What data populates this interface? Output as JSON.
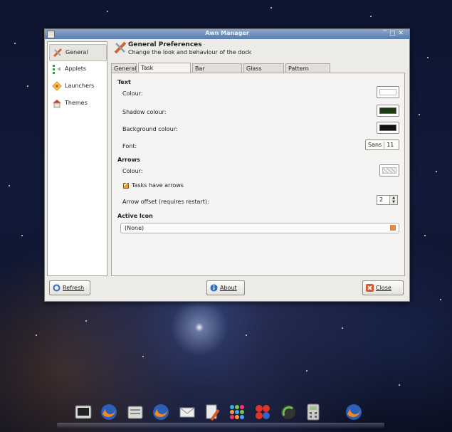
{
  "window": {
    "title": "Awn Manager"
  },
  "sidebar": {
    "items": [
      {
        "label": "General",
        "icon": "general-icon",
        "selected": true
      },
      {
        "label": "Applets",
        "icon": "applets-icon",
        "selected": false
      },
      {
        "label": "Launchers",
        "icon": "launchers-icon",
        "selected": false
      },
      {
        "label": "Themes",
        "icon": "themes-icon",
        "selected": false
      }
    ]
  },
  "header": {
    "title": "General Preferences",
    "subtitle": "Change the look and behaviour of the dock"
  },
  "tabs": [
    {
      "label": "General",
      "active": false
    },
    {
      "label": "Task Appearance",
      "active": true
    },
    {
      "label": "Bar Appearance",
      "active": false
    },
    {
      "label": "Glass Engine",
      "active": false
    },
    {
      "label": "Pattern Engine",
      "active": false
    }
  ],
  "text_section": {
    "heading": "Text",
    "colour_label": "Colour:",
    "colour_value": "#ffffff",
    "shadow_label": "Shadow colour:",
    "shadow_value": "#1e3a12",
    "background_label": "Background colour:",
    "background_value": "#111111",
    "font_label": "Font:",
    "font_name": "Sans",
    "font_size": "11"
  },
  "arrows_section": {
    "heading": "Arrows",
    "colour_label": "Colour:",
    "tasks_have_arrows_label": "Tasks have arrows",
    "tasks_have_arrows_checked": true,
    "offset_label": "Arrow offset (requires restart):",
    "offset_value": "2"
  },
  "active_icon_section": {
    "heading": "Active Icon",
    "value": "(None)"
  },
  "buttons": {
    "refresh": "Refresh",
    "about": "About",
    "close": "Close"
  },
  "dock": {
    "items": [
      "terminal-icon",
      "firefox-icon",
      "file-manager-icon",
      "firefox-icon",
      "mail-icon",
      "paint-icon",
      "colorful-grid-icon",
      "red-dots-icon",
      "network-icon",
      "calculator-icon",
      "firefox-icon"
    ]
  }
}
